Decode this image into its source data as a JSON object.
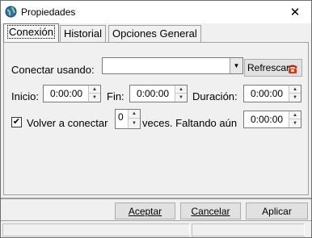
{
  "window": {
    "title": "Propiedades",
    "close_glyph": "✕"
  },
  "tabs": [
    {
      "label": "Conexión",
      "active": true
    },
    {
      "label": "Historial",
      "active": false
    },
    {
      "label": "Opciones General",
      "active": false
    }
  ],
  "connect": {
    "label": "Conectar usando:",
    "value": "",
    "refresh_label": "Refrescar",
    "icon": "phone-icon"
  },
  "times": {
    "start_label": "Inicio:",
    "start_value": "0:00:00",
    "end_label": "Fin:",
    "end_value": "0:00:00",
    "duration_label": "Duración:",
    "duration_value": "0:00:00"
  },
  "retry": {
    "checked": true,
    "label": "Volver a conectar",
    "count": "0",
    "times_label": "veces. Faltando aún",
    "remaining_value": "0:00:00"
  },
  "buttons": {
    "accept": "Aceptar",
    "cancel": "Cancelar",
    "apply": "Aplicar"
  }
}
